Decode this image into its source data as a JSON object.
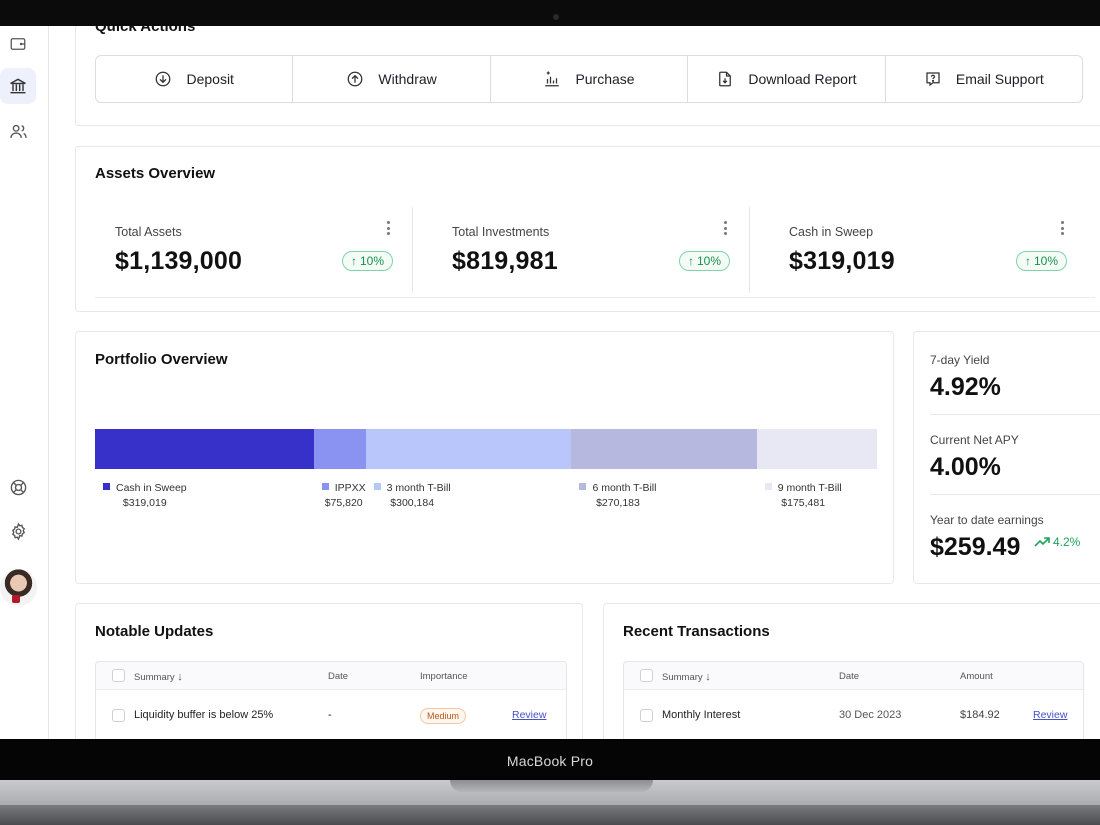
{
  "device": {
    "label": "MacBook Pro"
  },
  "quick_actions": {
    "title": "Quick Actions",
    "buttons": [
      {
        "label": "Deposit",
        "icon": "arrow-down-circle-icon"
      },
      {
        "label": "Withdraw",
        "icon": "arrow-up-circle-icon"
      },
      {
        "label": "Purchase",
        "icon": "chart-plus-icon"
      },
      {
        "label": "Download Report",
        "icon": "file-download-icon"
      },
      {
        "label": "Email Support",
        "icon": "chat-question-icon"
      }
    ]
  },
  "assets": {
    "title": "Assets Overview",
    "stats": [
      {
        "label": "Total Assets",
        "value": "$1,139,000",
        "change": "10%"
      },
      {
        "label": "Total Investments",
        "value": "$819,981",
        "change": "10%"
      },
      {
        "label": "Cash in Sweep",
        "value": "$319,019",
        "change": "10%"
      }
    ]
  },
  "portfolio": {
    "title": "Portfolio Overview",
    "segments": [
      {
        "name": "Cash in Sweep",
        "value": "$319,019",
        "amount": 319019,
        "color": "#3730c9"
      },
      {
        "name": "IPPXX",
        "value": "$75,820",
        "amount": 75820,
        "color": "#8b93f2"
      },
      {
        "name": "3 month T-Bill",
        "value": "$300,184",
        "amount": 300184,
        "color": "#b9c6fb"
      },
      {
        "name": "6 month T-Bill",
        "value": "$270,183",
        "amount": 270183,
        "color": "#b6b8e0"
      },
      {
        "name": "9 month T-Bill",
        "value": "$175,481",
        "amount": 175481,
        "color": "#e8e8f5"
      }
    ]
  },
  "metrics": {
    "yield_label": "7-day Yield",
    "yield_value": "4.92%",
    "apy_label": "Current Net APY",
    "apy_value": "4.00%",
    "ytd_label": "Year to date earnings",
    "ytd_value": "$259.49",
    "ytd_change": "4.2%",
    "trend_color": "#1fa35b"
  },
  "updates": {
    "title": "Notable Updates",
    "columns": {
      "summary": "Summary",
      "date": "Date",
      "importance": "Importance"
    },
    "rows": [
      {
        "summary": "Liquidity buffer is below 25%",
        "date": "-",
        "importance": "Medium",
        "action": "Review"
      }
    ]
  },
  "transactions": {
    "title": "Recent Transactions",
    "columns": {
      "summary": "Summary",
      "date": "Date",
      "amount": "Amount"
    },
    "rows": [
      {
        "summary": "Monthly Interest",
        "date": "30 Dec 2023",
        "amount": "$184.92",
        "action": "Review"
      }
    ]
  }
}
